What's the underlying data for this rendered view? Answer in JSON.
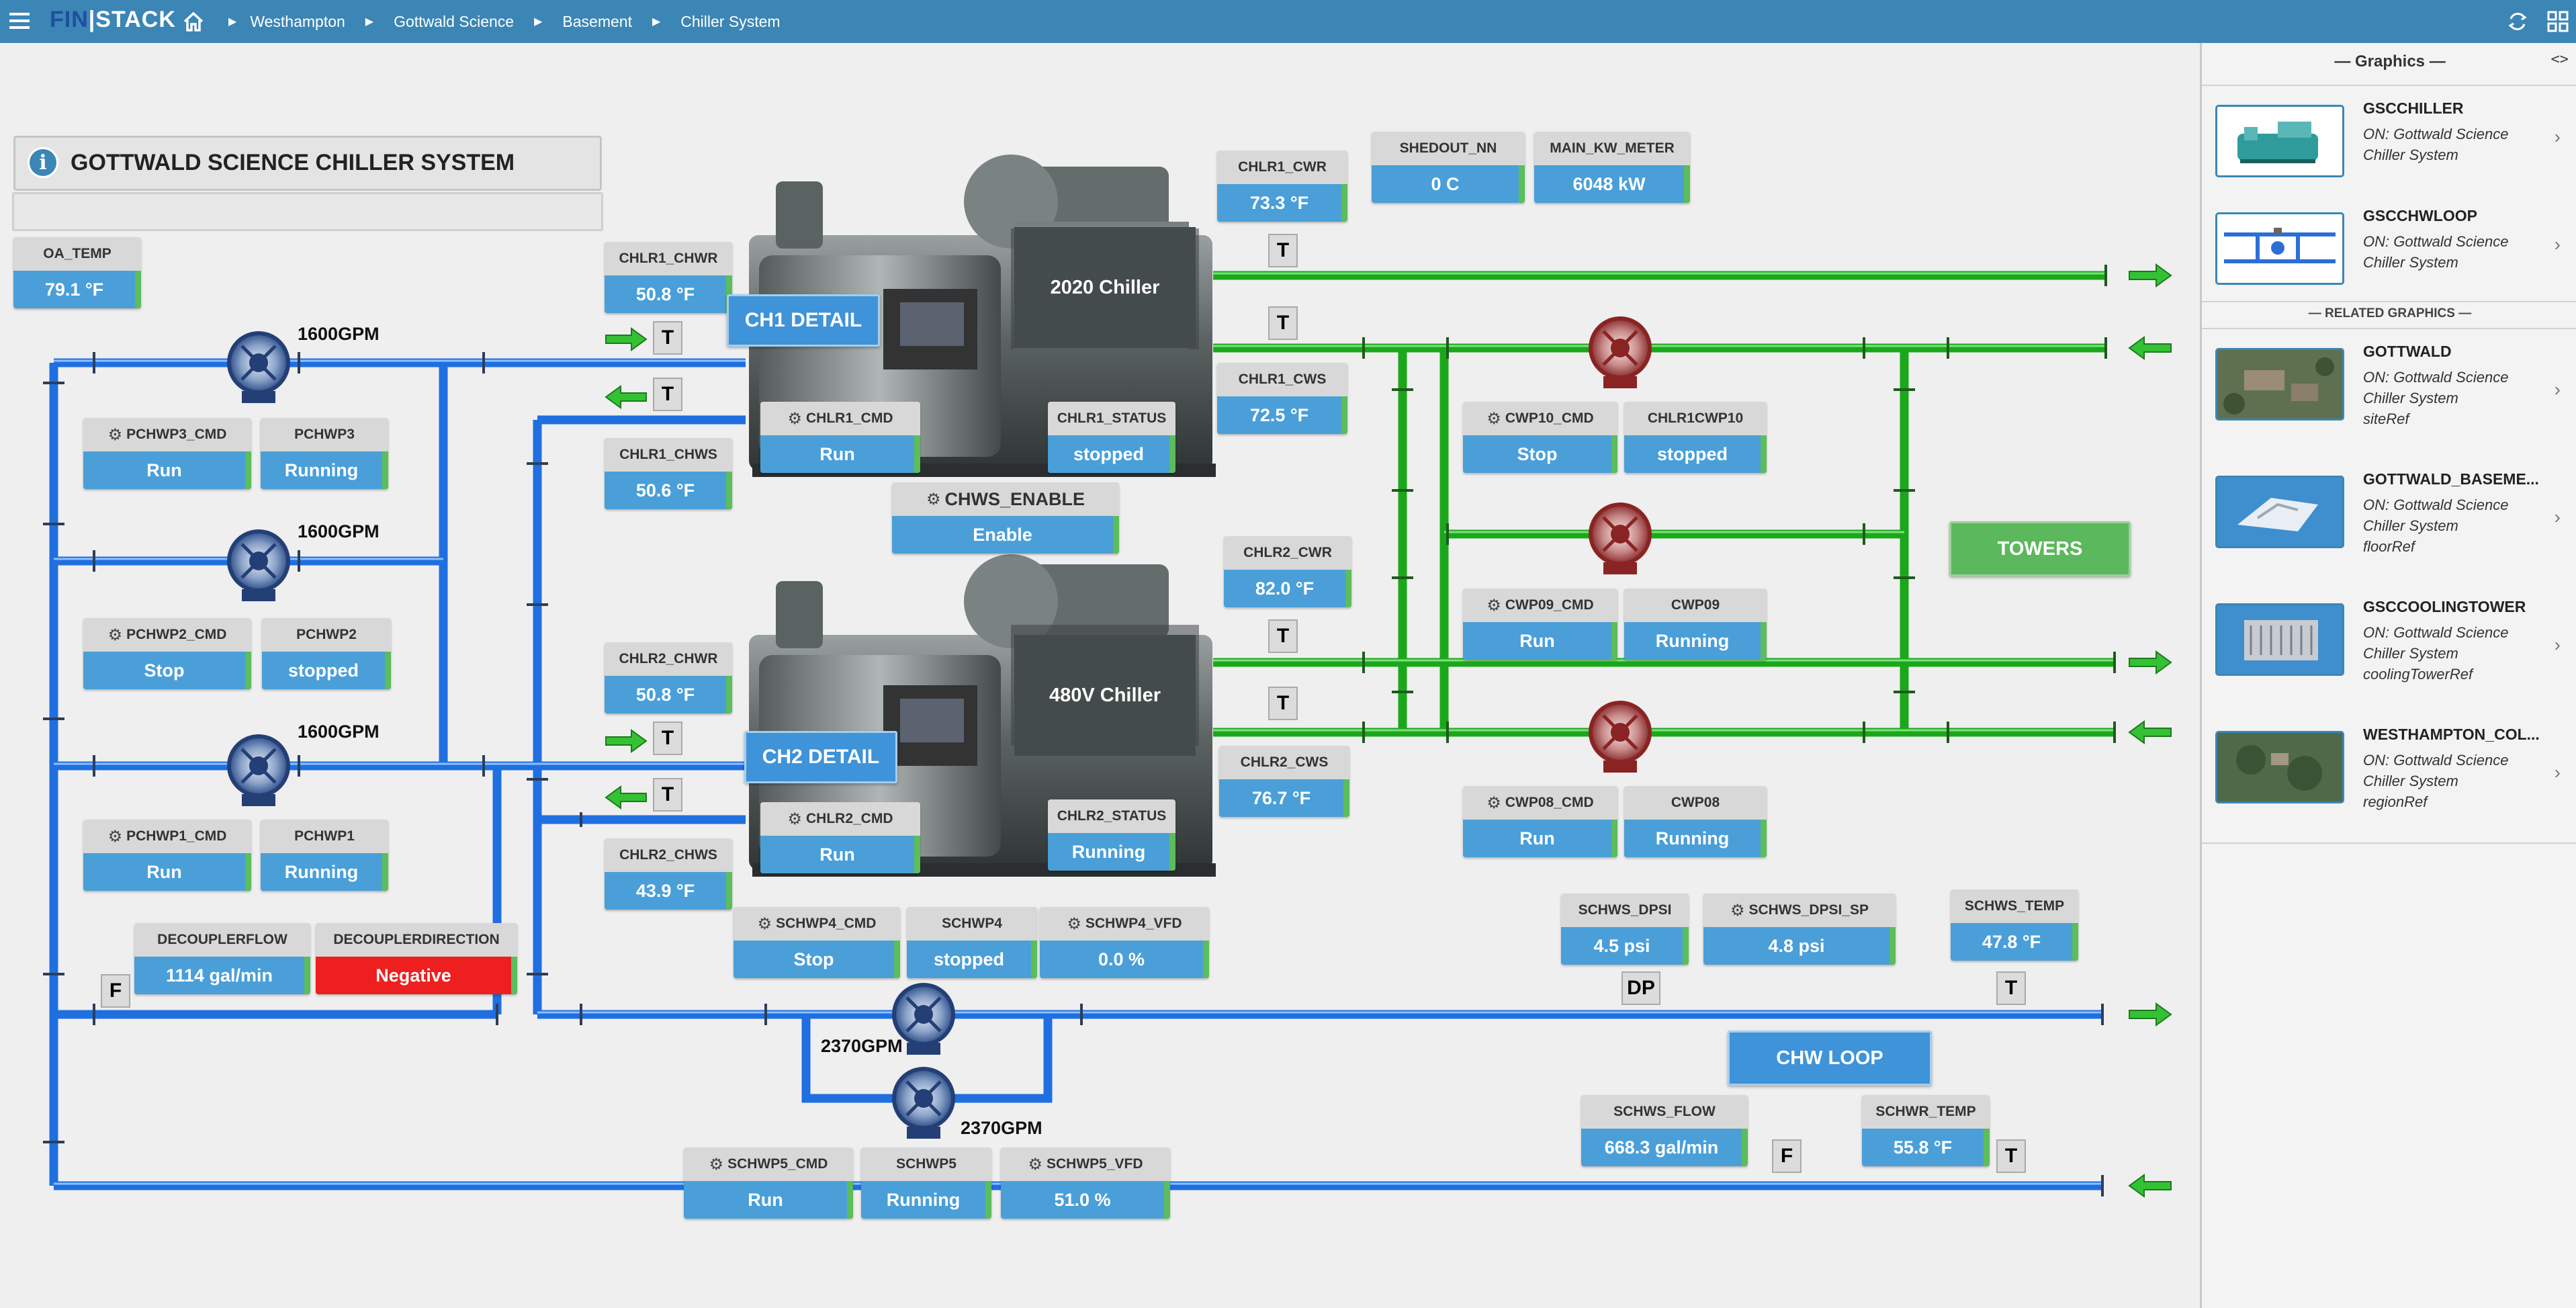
{
  "topbar": {
    "menu_icon": "hamburger-menu-icon",
    "logo_fin": "FIN",
    "logo_stack": "STACK",
    "home_icon": "home-icon",
    "breadcrumbs": [
      "Westhampton",
      "Gottwald Science",
      "Basement",
      "Chiller System"
    ],
    "right_icons": [
      "refresh-icon",
      "apps-grid-icon"
    ]
  },
  "page": {
    "title": "GOTTWALD SCIENCE CHILLER SYSTEM",
    "info_icon": "info-icon"
  },
  "points": {
    "oa_temp": {
      "label": "OA_TEMP",
      "value": "79.1 °F"
    },
    "chlr1_chwr": {
      "label": "CHLR1_CHWR",
      "value": "50.8 °F"
    },
    "chlr1_chws": {
      "label": "CHLR1_CHWS",
      "value": "50.6 °F"
    },
    "chlr1_cmd": {
      "label": "CHLR1_CMD",
      "value": "Run"
    },
    "chlr1_status": {
      "label": "CHLR1_STATUS",
      "value": "stopped"
    },
    "chlr1_cwr": {
      "label": "CHLR1_CWR",
      "value": "73.3 °F"
    },
    "chlr1_cws": {
      "label": "CHLR1_CWS",
      "value": "72.5 °F"
    },
    "shedout_nn": {
      "label": "SHEDOUT_NN",
      "value": "0 C"
    },
    "main_kw_meter": {
      "label": "MAIN_KW_METER",
      "value": "6048 kW"
    },
    "chws_enable": {
      "label": "CHWS_ENABLE",
      "value": "Enable"
    },
    "pchwp3_cmd": {
      "label": "PCHWP3_CMD",
      "value": "Run"
    },
    "pchwp3": {
      "label": "PCHWP3",
      "value": "Running"
    },
    "pchwp2_cmd": {
      "label": "PCHWP2_CMD",
      "value": "Stop"
    },
    "pchwp2": {
      "label": "PCHWP2",
      "value": "stopped"
    },
    "pchwp1_cmd": {
      "label": "PCHWP1_CMD",
      "value": "Run"
    },
    "pchwp1": {
      "label": "PCHWP1",
      "value": "Running"
    },
    "chlr2_chwr": {
      "label": "CHLR2_CHWR",
      "value": "50.8 °F"
    },
    "chlr2_chws": {
      "label": "CHLR2_CHWS",
      "value": "43.9 °F"
    },
    "chlr2_cmd": {
      "label": "CHLR2_CMD",
      "value": "Run"
    },
    "chlr2_status": {
      "label": "CHLR2_STATUS",
      "value": "Running"
    },
    "chlr2_cwr": {
      "label": "CHLR2_CWR",
      "value": "82.0 °F"
    },
    "chlr2_cws": {
      "label": "CHLR2_CWS",
      "value": "76.7 °F"
    },
    "cwp10_cmd": {
      "label": "CWP10_CMD",
      "value": "Stop"
    },
    "chlr1cwp10": {
      "label": "CHLR1CWP10",
      "value": "stopped"
    },
    "cwp09_cmd": {
      "label": "CWP09_CMD",
      "value": "Run"
    },
    "cwp09": {
      "label": "CWP09",
      "value": "Running"
    },
    "cwp08_cmd": {
      "label": "CWP08_CMD",
      "value": "Run"
    },
    "cwp08": {
      "label": "CWP08",
      "value": "Running"
    },
    "decouplerflow": {
      "label": "DECOUPLERFLOW",
      "value": "1114 gal/min"
    },
    "decouplerdirection": {
      "label": "DECOUPLERDIRECTION",
      "value": "Negative"
    },
    "schwp4_cmd": {
      "label": "SCHWP4_CMD",
      "value": "Stop"
    },
    "schwp4": {
      "label": "SCHWP4",
      "value": "stopped"
    },
    "schwp4_vfd": {
      "label": "SCHWP4_VFD",
      "value": "0.0 %"
    },
    "schwp5_cmd": {
      "label": "SCHWP5_CMD",
      "value": "Run"
    },
    "schwp5": {
      "label": "SCHWP5",
      "value": "Running"
    },
    "schwp5_vfd": {
      "label": "SCHWP5_VFD",
      "value": "51.0 %"
    },
    "schws_dpsi": {
      "label": "SCHWS_DPSI",
      "value": "4.5 psi"
    },
    "schws_dpsi_sp": {
      "label": "SCHWS_DPSI_SP",
      "value": "4.8 psi"
    },
    "schws_temp": {
      "label": "SCHWS_TEMP",
      "value": "47.8 °F"
    },
    "schws_flow": {
      "label": "SCHWS_FLOW",
      "value": "668.3 gal/min"
    },
    "schwr_temp": {
      "label": "SCHWR_TEMP",
      "value": "55.8 °F"
    }
  },
  "equipment": {
    "chiller1_name": "2020 Chiller",
    "chiller2_name": "480V Chiller",
    "ch1_detail": "CH1 DETAIL",
    "ch2_detail": "CH2 DETAIL",
    "towers": "TOWERS",
    "chw_loop": "CHW LOOP",
    "pump_flow_1600": "1600GPM",
    "pump_flow_2370": "2370GPM",
    "sensor_t": "T",
    "sensor_f": "F",
    "sensor_dp": "DP"
  },
  "colors": {
    "chw_pipe": "#1f6fe0",
    "cw_pipe": "#17b517",
    "value_bg": "#4a9fd8",
    "alarm": "#ee1f1f",
    "topbar": "#3b86b5"
  },
  "sidebar": {
    "toggle_icon": "collapse-toggle-icon",
    "header": "— Graphics —",
    "related_header": "— RELATED GRAPHICS —",
    "graphics": [
      {
        "title": "GSCCHILLER",
        "subtitle": "ON: Gottwald Science Chiller System",
        "ref": ""
      },
      {
        "title": "GSCCHWLOOP",
        "subtitle": "ON: Gottwald Science Chiller System",
        "ref": ""
      }
    ],
    "related": [
      {
        "title": "GOTTWALD",
        "subtitle": "ON: Gottwald Science Chiller System",
        "ref": "siteRef"
      },
      {
        "title": "GOTTWALD_BASEME...",
        "subtitle": "ON: Gottwald Science Chiller System",
        "ref": "floorRef"
      },
      {
        "title": "GSCCOOLINGTOWER",
        "subtitle": "ON: Gottwald Science Chiller System",
        "ref": "coolingTowerRef"
      },
      {
        "title": "WESTHAMPTON_COL...",
        "subtitle": "ON: Gottwald Science Chiller System",
        "ref": "regionRef"
      }
    ]
  }
}
